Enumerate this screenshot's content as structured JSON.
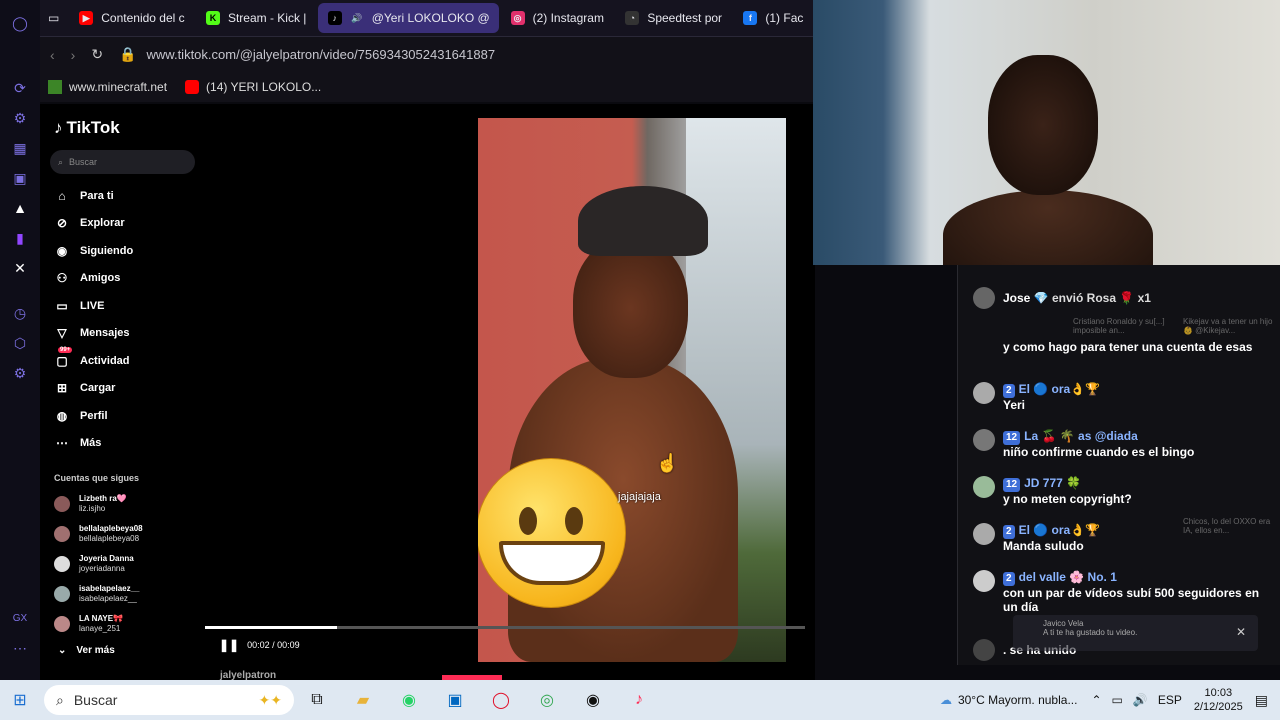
{
  "browser": {
    "tabs": [
      {
        "label": "Contenido del c",
        "icon": "youtube-icon",
        "color": "#ff0000"
      },
      {
        "label": "Stream - Kick |",
        "icon": "kick-icon",
        "color": "#53fc18"
      },
      {
        "label": "@Yeri LOKOLOKO @",
        "icon": "tiktok-icon",
        "color": "#000000",
        "active": true
      },
      {
        "label": "(2) Instagram",
        "icon": "instagram-icon",
        "color": "#e1306c"
      },
      {
        "label": "Speedtest por",
        "icon": "speedtest-icon",
        "color": "#333333"
      },
      {
        "label": "(1) Fac",
        "icon": "facebook-icon",
        "color": "#1877f2"
      }
    ],
    "url": "www.tiktok.com/@jalyelpatron/video/7569343052431641887",
    "bookmarks": [
      {
        "label": "www.minecraft.net",
        "icon": "minecraft-icon"
      },
      {
        "label": "(14) YERI LOKOLO...",
        "icon": "youtube-icon"
      }
    ]
  },
  "tiktok": {
    "logo": "TikTok",
    "search_placeholder": "Buscar",
    "nav": [
      {
        "label": "Para ti",
        "icon": "home-icon"
      },
      {
        "label": "Explorar",
        "icon": "compass-icon"
      },
      {
        "label": "Siguiendo",
        "icon": "following-icon"
      },
      {
        "label": "Amigos",
        "icon": "friends-icon"
      },
      {
        "label": "LIVE",
        "icon": "live-icon"
      },
      {
        "label": "Mensajes",
        "icon": "messages-icon"
      },
      {
        "label": "Actividad",
        "icon": "activity-icon",
        "badge": "99+"
      },
      {
        "label": "Cargar",
        "icon": "upload-icon"
      },
      {
        "label": "Perfil",
        "icon": "profile-icon"
      },
      {
        "label": "Más",
        "icon": "more-icon"
      }
    ],
    "following_title": "Cuentas que sigues",
    "following": [
      {
        "name": "Lizbeth ra🩷",
        "handle": "liz.isjho"
      },
      {
        "name": "bellalaplebeya08",
        "handle": "bellalaplebeya08"
      },
      {
        "name": "Joyeria Danna",
        "handle": "joyeriadanna"
      },
      {
        "name": "isabelapelaez__",
        "handle": "isabelapelaez__"
      },
      {
        "name": "LA NAYE🎀",
        "handle": "lanaye_251"
      }
    ],
    "see_more": "Ver más",
    "video": {
      "caption": "jajajajaja",
      "time": "00:02 / 00:09",
      "progress": 0.22,
      "author": "jalyelpatron"
    }
  },
  "chat": {
    "messages": [
      {
        "user": "Jose 💎",
        "text": "envió Rosa 🌹 x1",
        "type": "gift"
      },
      {
        "user": "",
        "text": "y como hago para tener una cuenta de esas"
      },
      {
        "badge": "2",
        "user": "El 🔵 ora👌🏆",
        "text": "Yeri"
      },
      {
        "badge": "12",
        "user": "La 🍒 🌴 as @diada",
        "text": "niño confirme cuando es el bingo"
      },
      {
        "badge": "12",
        "user": "JD 777 🍀",
        "text": "y no meten copyright?"
      },
      {
        "badge": "2",
        "user": "El 🔵 ora👌🏆",
        "text": "Manda suludo"
      },
      {
        "badge": "2",
        "user": "del valle 🌸 No. 1",
        "text": "con un par de vídeos subí 500 seguidores en un día"
      },
      {
        "user": "",
        "text": ". se ha unido",
        "type": "join"
      }
    ],
    "bg_notes": [
      "Cristiano Ronaldo y su[...] imposible an...",
      "Kikejav va a tener un hijo 👶 @Kikejav...",
      "Chicos, lo del OXXO era IA, ellos en...",
      "Javico Vela",
      "A ti te ha gustado tu video."
    ]
  },
  "taskbar": {
    "search_placeholder": "Buscar",
    "weather": "30°C  Mayorm. nubla...",
    "language": "ESP",
    "time": "10:03",
    "date": "2/12/2025"
  }
}
